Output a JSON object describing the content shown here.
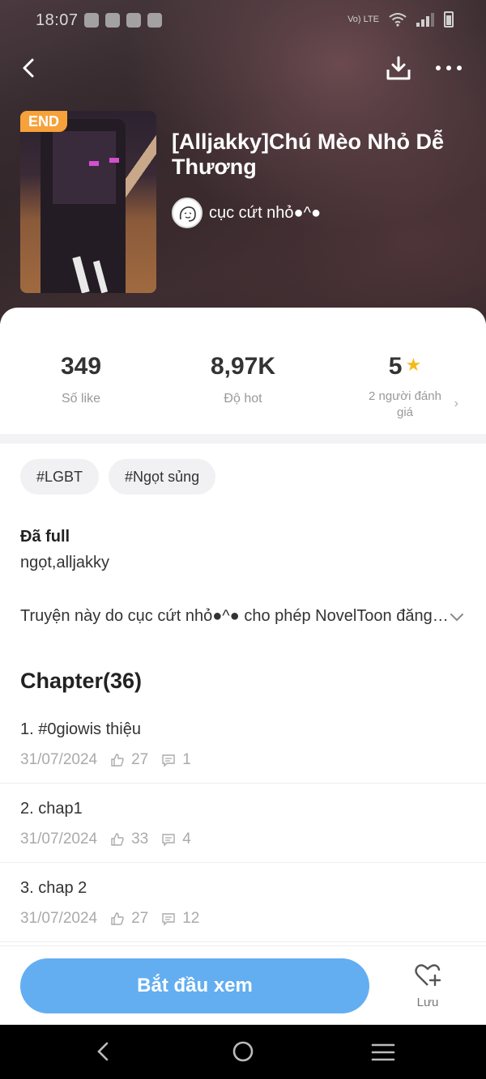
{
  "status_bar": {
    "time": "18:07",
    "network_label": "Vo) LTE"
  },
  "header": {
    "badge": "END",
    "title": "[Alljakky]Chú Mèo Nhỏ Dễ Thương",
    "author": "cục cứt nhỏ●^●"
  },
  "stats": [
    {
      "value": "349",
      "label": "Số like"
    },
    {
      "value": "8,97K",
      "label": "Độ hot"
    },
    {
      "value": "5",
      "label": "2 người đánh giá"
    }
  ],
  "tags": [
    "#LGBT",
    "#Ngọt sủng"
  ],
  "info": {
    "status": "Đã full",
    "keywords": "ngọt,alljakky",
    "description": "Truyện này do cục cứt nhỏ●^● cho phép NovelToon đăng tải"
  },
  "chapters_title": "Chapter(36)",
  "chapters": [
    {
      "title": "1. #0giowis thiệu",
      "date": "31/07/2024",
      "likes": "27",
      "comments": "1"
    },
    {
      "title": "2. chap1",
      "date": "31/07/2024",
      "likes": "33",
      "comments": "4"
    },
    {
      "title": "3. chap 2",
      "date": "31/07/2024",
      "likes": "27",
      "comments": "12"
    }
  ],
  "bottom": {
    "start_label": "Bắt đầu xem",
    "save_label": "Lưu"
  },
  "colors": {
    "accent": "#63aef1",
    "badge": "#f6a13a",
    "star": "#f6b91a"
  }
}
